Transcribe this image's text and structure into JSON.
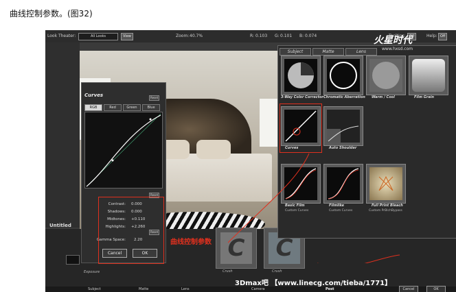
{
  "caption": "曲线控制参数。(图32)",
  "toolbar": {
    "look_theater_label": "Look Theater:",
    "look_value": "All Looks",
    "view_button": "View",
    "zoom_label": "Zoom:",
    "zoom_value": "40.7%",
    "r_label": "R:",
    "r_value": "0.103",
    "g_label": "G:",
    "g_value": "0.101",
    "b_label": "B:",
    "b_value": "0.074",
    "tooltips_label": "Tooltips:",
    "tooltips_value": "Off",
    "help_label": "Help:",
    "help_value": "Off"
  },
  "curves": {
    "title": "Curves",
    "reset": "Reset",
    "channels": [
      "RGB",
      "Red",
      "Green",
      "Blue"
    ],
    "active_channel": "RGB",
    "stats": [
      {
        "label": "Contrast:",
        "value": "0.000"
      },
      {
        "label": "Shadows:",
        "value": "0.000"
      },
      {
        "label": "Midtones:",
        "value": "+0.110"
      },
      {
        "label": "Highlights:",
        "value": "+2.260"
      }
    ],
    "gamma_label": "Gamma Space:",
    "gamma_value": "2.20",
    "cancel": "Cancel",
    "ok": "OK"
  },
  "lens_panel": {
    "tabs": [
      "Subject",
      "Matte",
      "Lens"
    ],
    "tools": [
      {
        "label": "3-Way Color Corrector",
        "sub": ""
      },
      {
        "label": "Chromatic Aberration",
        "sub": ""
      },
      {
        "label": "Warm / Cool",
        "sub": ""
      },
      {
        "label": "Film Grain",
        "sub": ""
      },
      {
        "label": "Curves",
        "sub": ""
      },
      {
        "label": "Auto Shoulder",
        "sub": ""
      },
      {
        "label": "Basic Film",
        "sub": "Custom Curves"
      },
      {
        "label": "Filmlike",
        "sub": "Custom Curves"
      },
      {
        "label": "Full Print Bleach",
        "sub": "Custom PrBlchBypass"
      }
    ]
  },
  "bottom": {
    "untitled": "Untitled",
    "exposure": "Exposure",
    "crush1": "Crush",
    "crush2": "Crush",
    "tabs": [
      "Subject",
      "Matte",
      "Lens",
      "Camera",
      "Post"
    ],
    "cancel": "Cancel",
    "ok": "OK"
  },
  "annotations": {
    "curves_note": "曲线控制参数",
    "watermark_logo": "火星时代",
    "watermark_url": "www.hxsd.com",
    "watermark_bottom": "3Dmax吧 【www.linecg.com/tieba/1771】"
  },
  "colors": {
    "annotation_red": "#e0301e",
    "panel_bg": "#2a2a2a"
  }
}
